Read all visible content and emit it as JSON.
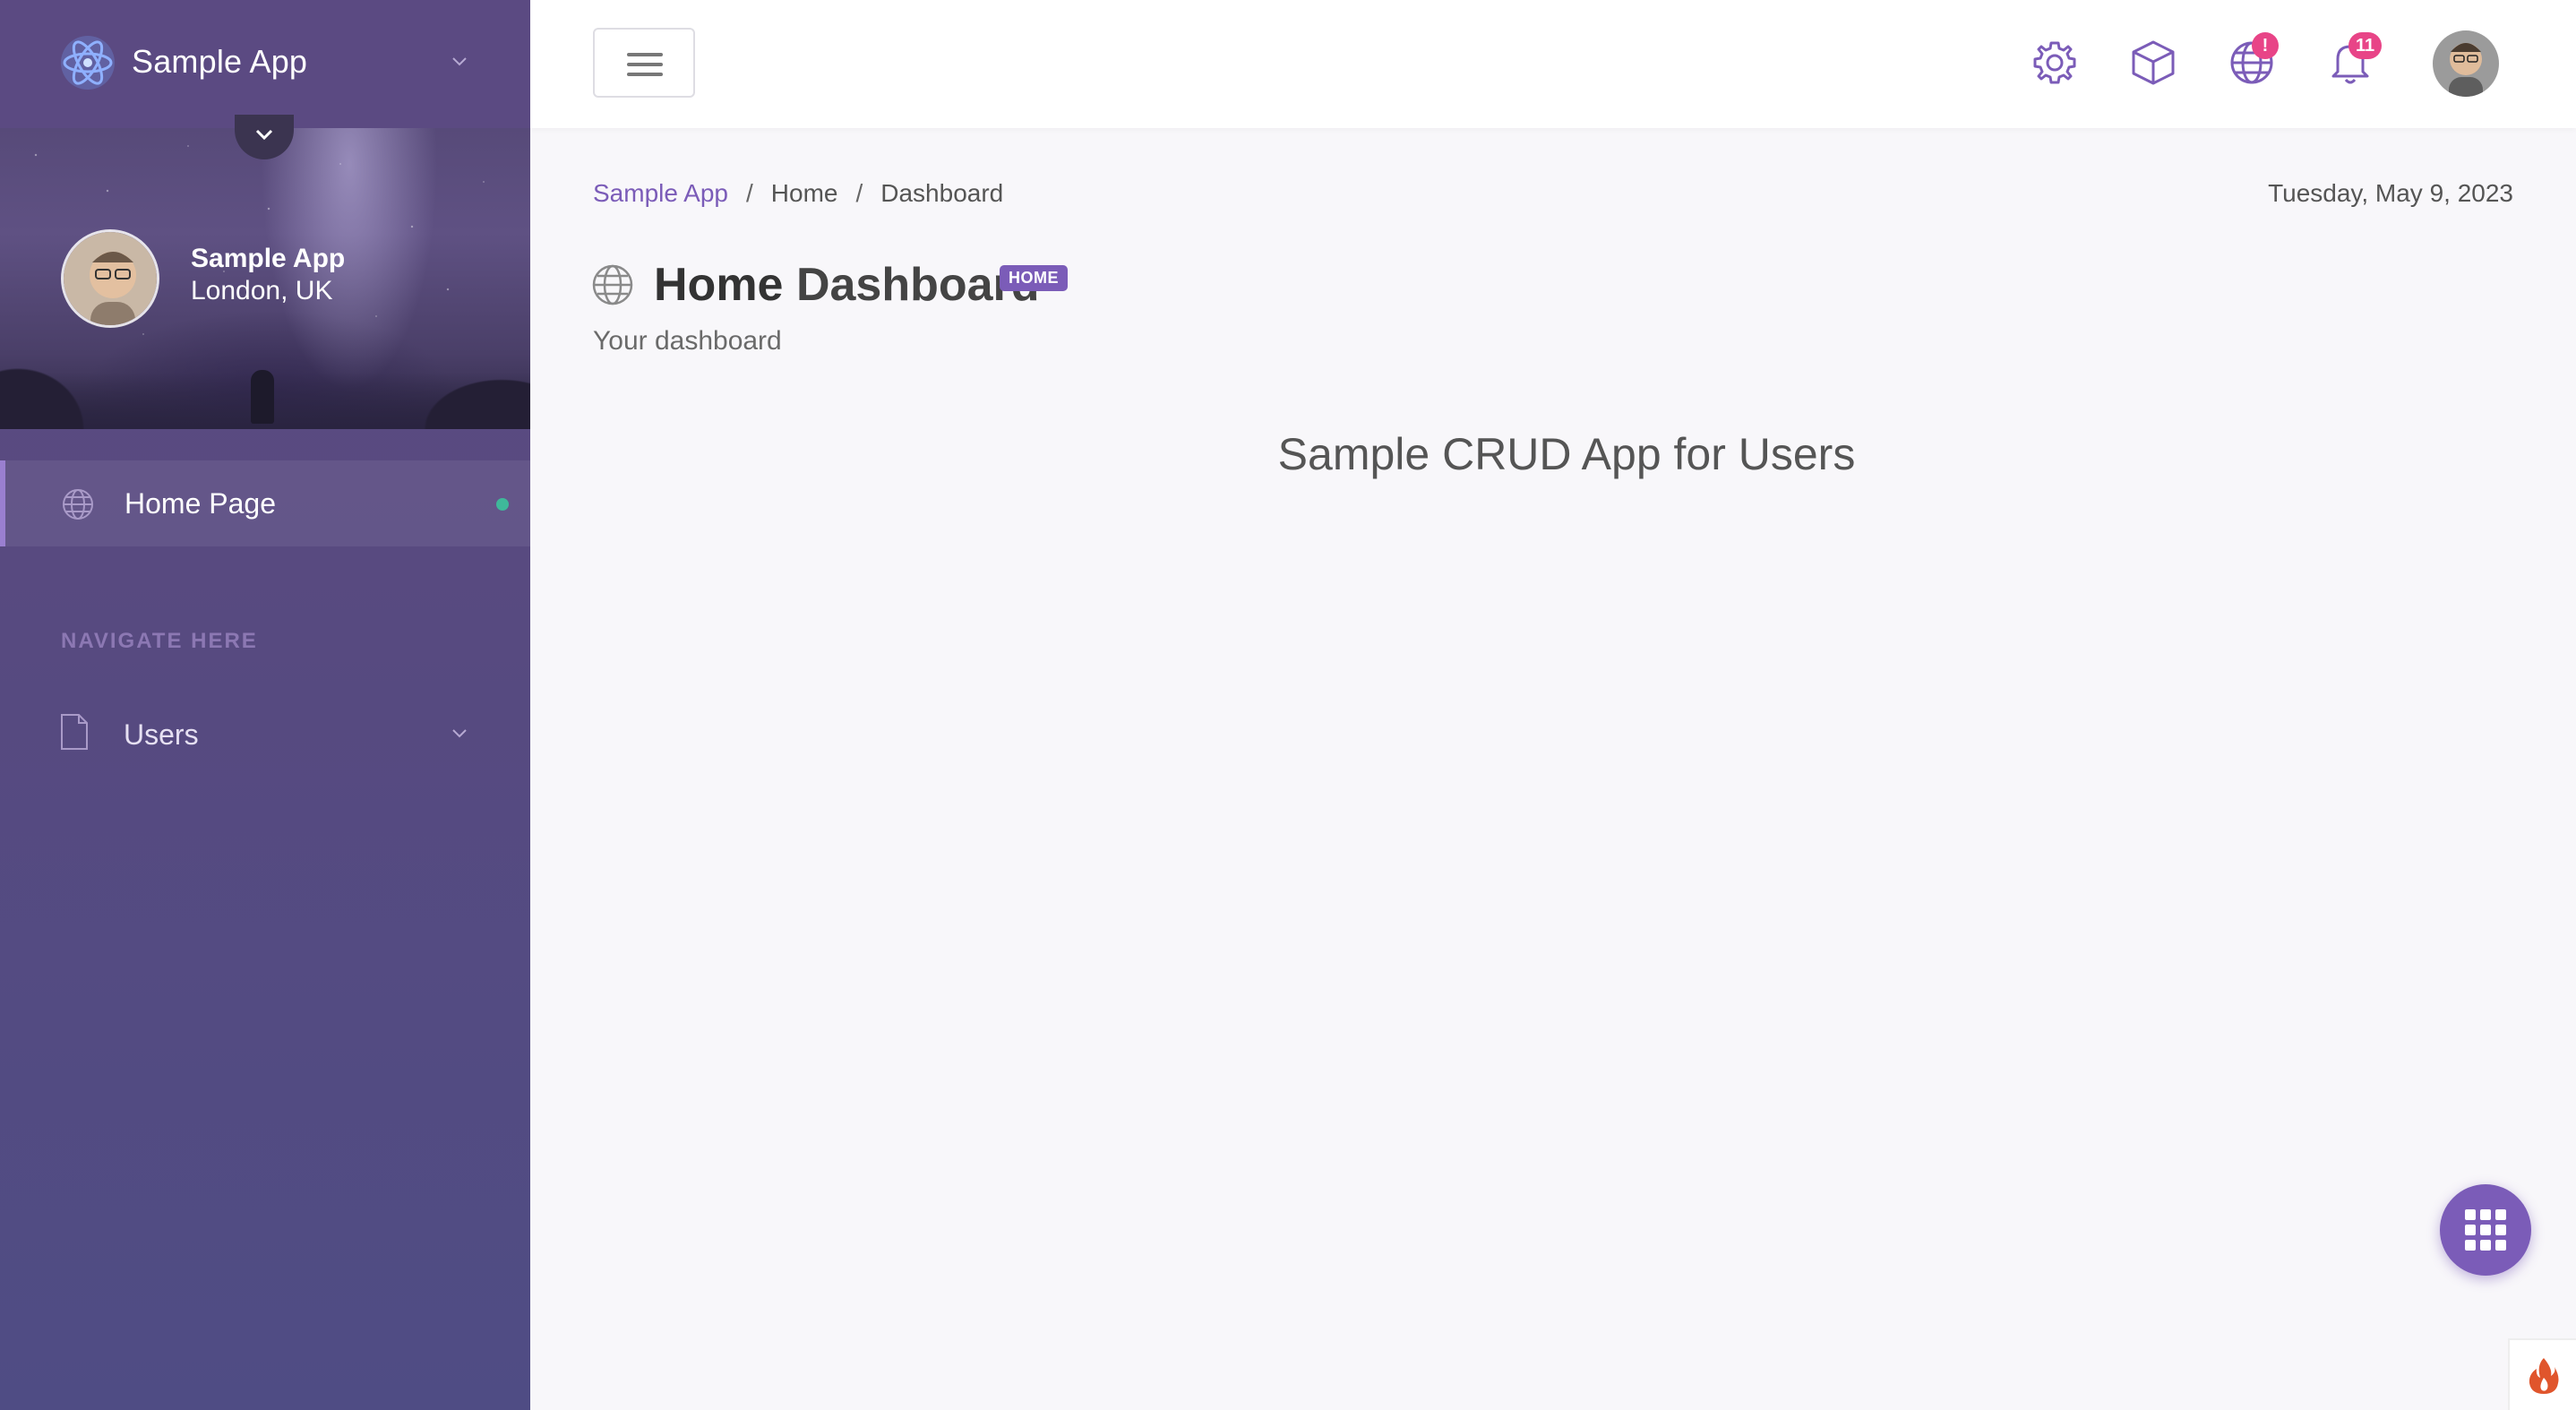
{
  "sidebar": {
    "brand": "Sample App",
    "profile": {
      "name": "Sample App",
      "location": "London, UK"
    },
    "nav_home": "Home Page",
    "section_title": "NAVIGATE HERE",
    "nav_users": "Users"
  },
  "header": {
    "icons": [
      "gear-icon",
      "box-icon",
      "globe-icon",
      "bell-icon"
    ],
    "globe_badge": "!",
    "bell_badge": "11"
  },
  "breadcrumb": {
    "app": "Sample App",
    "home": "Home",
    "current": "Dashboard",
    "separator": "/"
  },
  "date": "Tuesday, May 9, 2023",
  "page": {
    "title_bold": "Home",
    "title_rest": "Dashboard",
    "badge": "HOME",
    "subtitle": "Your dashboard"
  },
  "main": {
    "hero": "Sample CRUD App for Users"
  },
  "colors": {
    "accent": "#7b5cb8",
    "sidebar": "#574a80",
    "badge": "#e84487",
    "active_dot": "#3fb89a"
  }
}
